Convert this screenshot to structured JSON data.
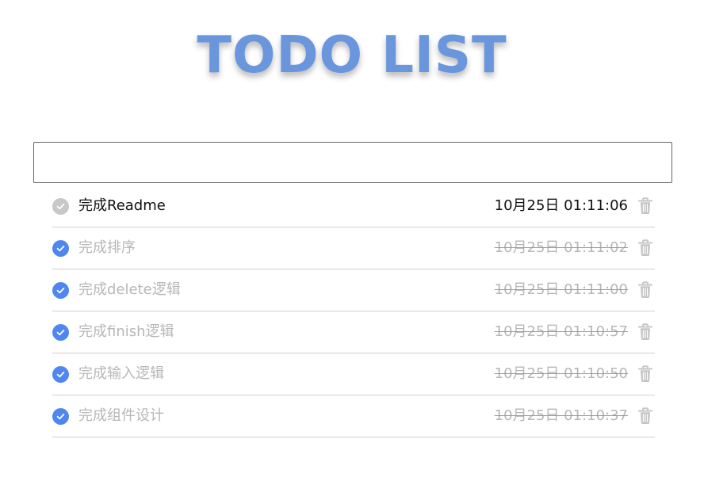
{
  "app": {
    "title": "TODO LIST"
  },
  "new_todo": {
    "value": "",
    "placeholder": ""
  },
  "colors": {
    "title": "#6a96dd",
    "check_done": "#4f86f0",
    "check_pending": "#c8c8c8",
    "muted_text": "#b7b7b7",
    "trash": "#c5c5c5"
  },
  "icons": {
    "check": "check-icon",
    "delete": "trash-icon"
  },
  "todos": [
    {
      "text": "完成Readme",
      "time": "10月25日 01:11:06",
      "completed": false
    },
    {
      "text": "完成排序",
      "time": "10月25日 01:11:02",
      "completed": true
    },
    {
      "text": "完成delete逻辑",
      "time": "10月25日 01:11:00",
      "completed": true
    },
    {
      "text": "完成finish逻辑",
      "time": "10月25日 01:10:57",
      "completed": true
    },
    {
      "text": "完成输入逻辑",
      "time": "10月25日 01:10:50",
      "completed": true
    },
    {
      "text": "完成组件设计",
      "time": "10月25日 01:10:37",
      "completed": true
    }
  ]
}
